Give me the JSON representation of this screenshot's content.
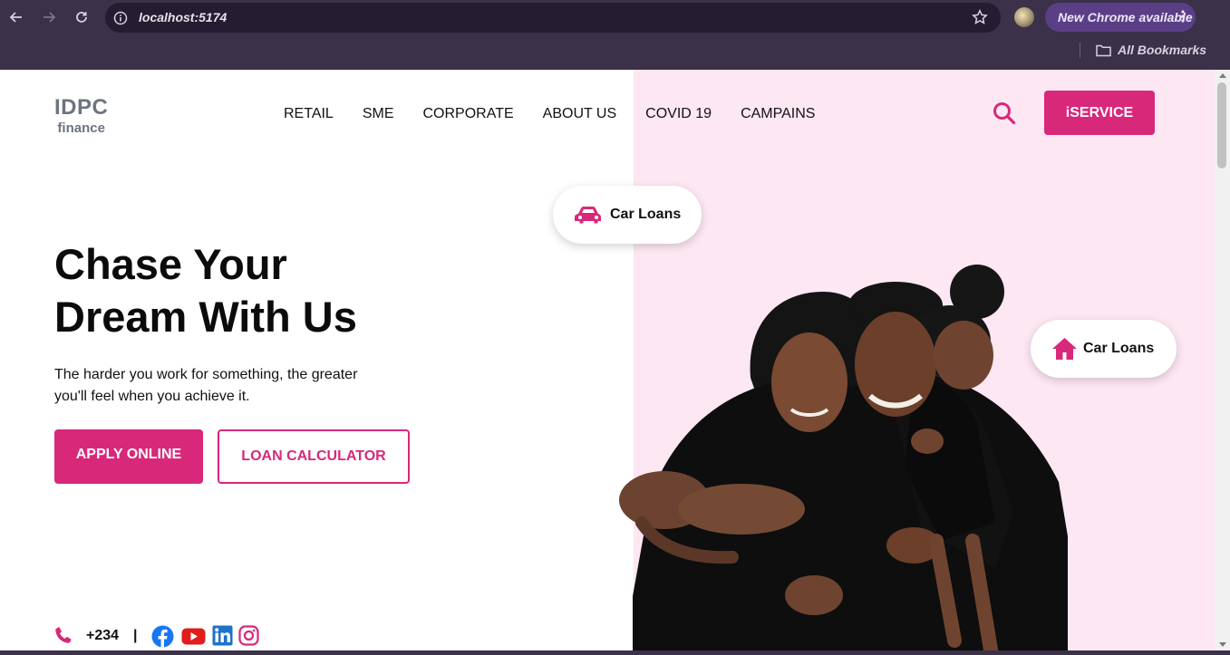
{
  "browser": {
    "url": "localhost:5174",
    "update_label": "New Chrome available",
    "bookmarks_label": "All Bookmarks"
  },
  "site": {
    "logo": {
      "main": "IDPC",
      "sub": "finance"
    },
    "nav": [
      "RETAIL",
      "SME",
      "CORPORATE",
      "ABOUT US",
      "COVID 19",
      "CAMPAINS"
    ],
    "iservice_label": "iSERVICE",
    "hero": {
      "title_line1": "Chase Your",
      "title_line2": "Dream With Us",
      "subtitle": "The harder you work for something, the greater you'll feel when you achieve it.",
      "apply_label": "APPLY ONLINE",
      "calc_label": "LOAN CALCULATOR"
    },
    "chips": [
      {
        "icon": "car-icon",
        "label": "Car Loans"
      },
      {
        "icon": "home-icon",
        "label": "Car Loans"
      }
    ],
    "contact": {
      "phone": "+234",
      "separator": "|",
      "socials": [
        "facebook-icon",
        "youtube-icon",
        "linkedin-icon",
        "instagram-icon"
      ]
    }
  },
  "colors": {
    "brand_pink": "#d8287a",
    "panel_pink": "#fde7f3",
    "chrome_bg": "#3b3148"
  }
}
